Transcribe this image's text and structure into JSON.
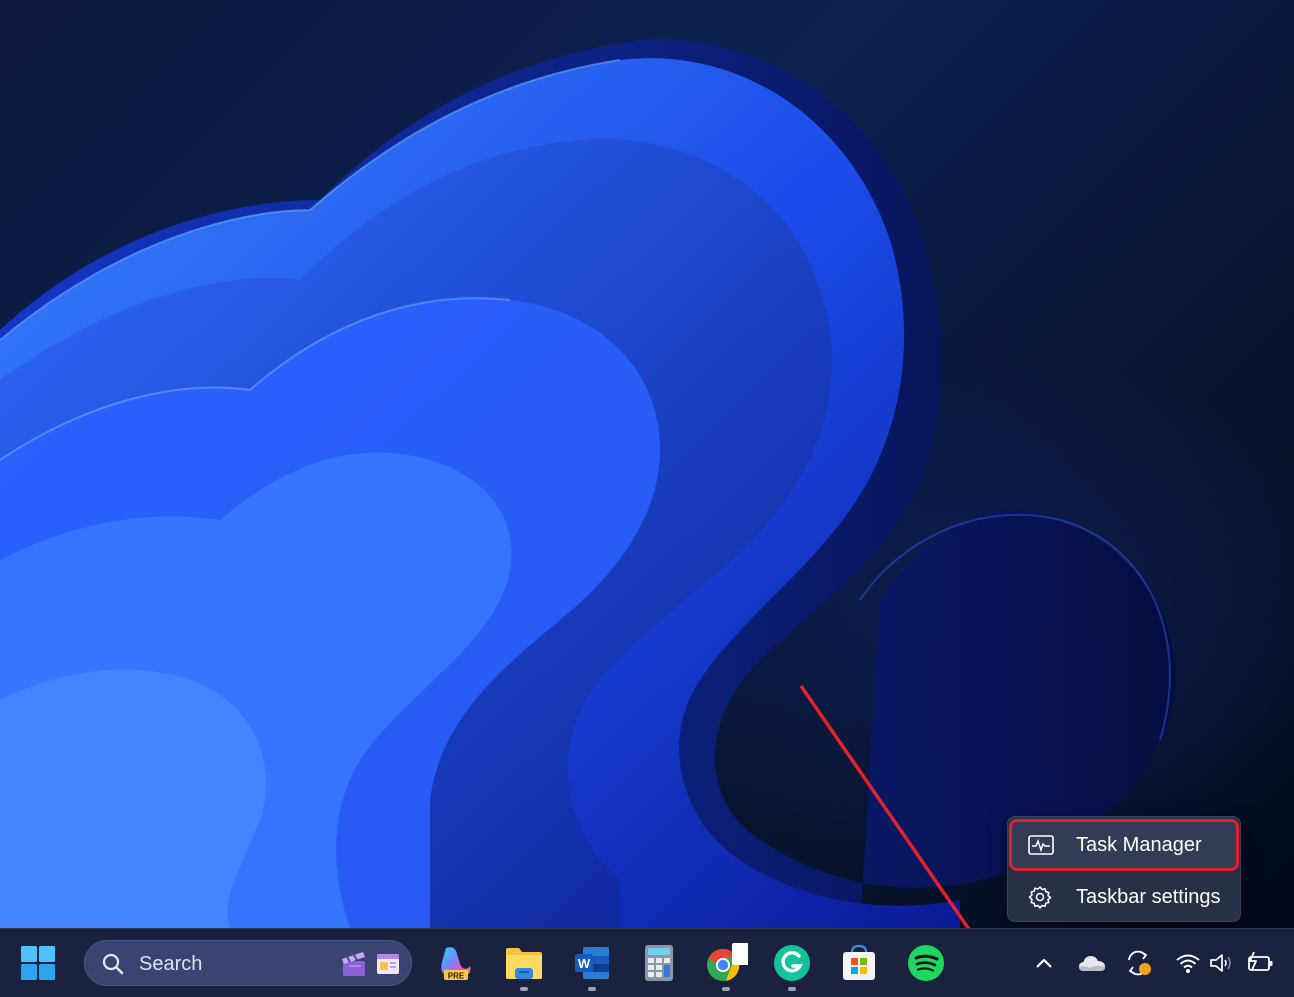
{
  "context_menu": {
    "items": [
      {
        "label": "Task Manager",
        "icon": "task-manager-icon",
        "highlighted": true
      },
      {
        "label": "Taskbar settings",
        "icon": "gear-icon",
        "highlighted": false
      }
    ]
  },
  "taskbar": {
    "start": {
      "icon": "windows-start-icon"
    },
    "search": {
      "label": "Search",
      "icon": "search-icon",
      "highlights": [
        "clapperboard-icon",
        "news-card-icon"
      ]
    },
    "pinned_apps": [
      {
        "name": "Copilot",
        "icon": "copilot-icon",
        "badge": "PRE",
        "running": false
      },
      {
        "name": "File Explorer",
        "icon": "folder-icon",
        "running": true
      },
      {
        "name": "Word",
        "icon": "word-icon",
        "badge": "W",
        "running": true
      },
      {
        "name": "Calculator",
        "icon": "calculator-icon",
        "running": false
      },
      {
        "name": "Chrome",
        "icon": "chrome-icon",
        "running": true
      },
      {
        "name": "Grammarly",
        "icon": "grammarly-icon",
        "badge": "G",
        "running": true
      },
      {
        "name": "Microsoft Store",
        "icon": "store-icon",
        "running": false
      },
      {
        "name": "Spotify",
        "icon": "spotify-icon",
        "running": false
      }
    ],
    "tray": [
      {
        "name": "show-hidden-icons",
        "icon": "chevron-up-icon"
      },
      {
        "name": "OneDrive",
        "icon": "cloud-icon"
      },
      {
        "name": "Sync",
        "icon": "sync-icon"
      },
      {
        "name": "Wi-Fi",
        "icon": "wifi-icon"
      },
      {
        "name": "Volume",
        "icon": "speaker-icon"
      },
      {
        "name": "Battery",
        "icon": "battery-charging-icon"
      }
    ]
  },
  "annotation": {
    "arrow_color": "#e0222e",
    "highlight_color": "#e0222e"
  },
  "colors": {
    "taskbar_bg": "#1a2240",
    "menu_bg": "#283046",
    "wallpaper_blue": "#1e4dff"
  }
}
